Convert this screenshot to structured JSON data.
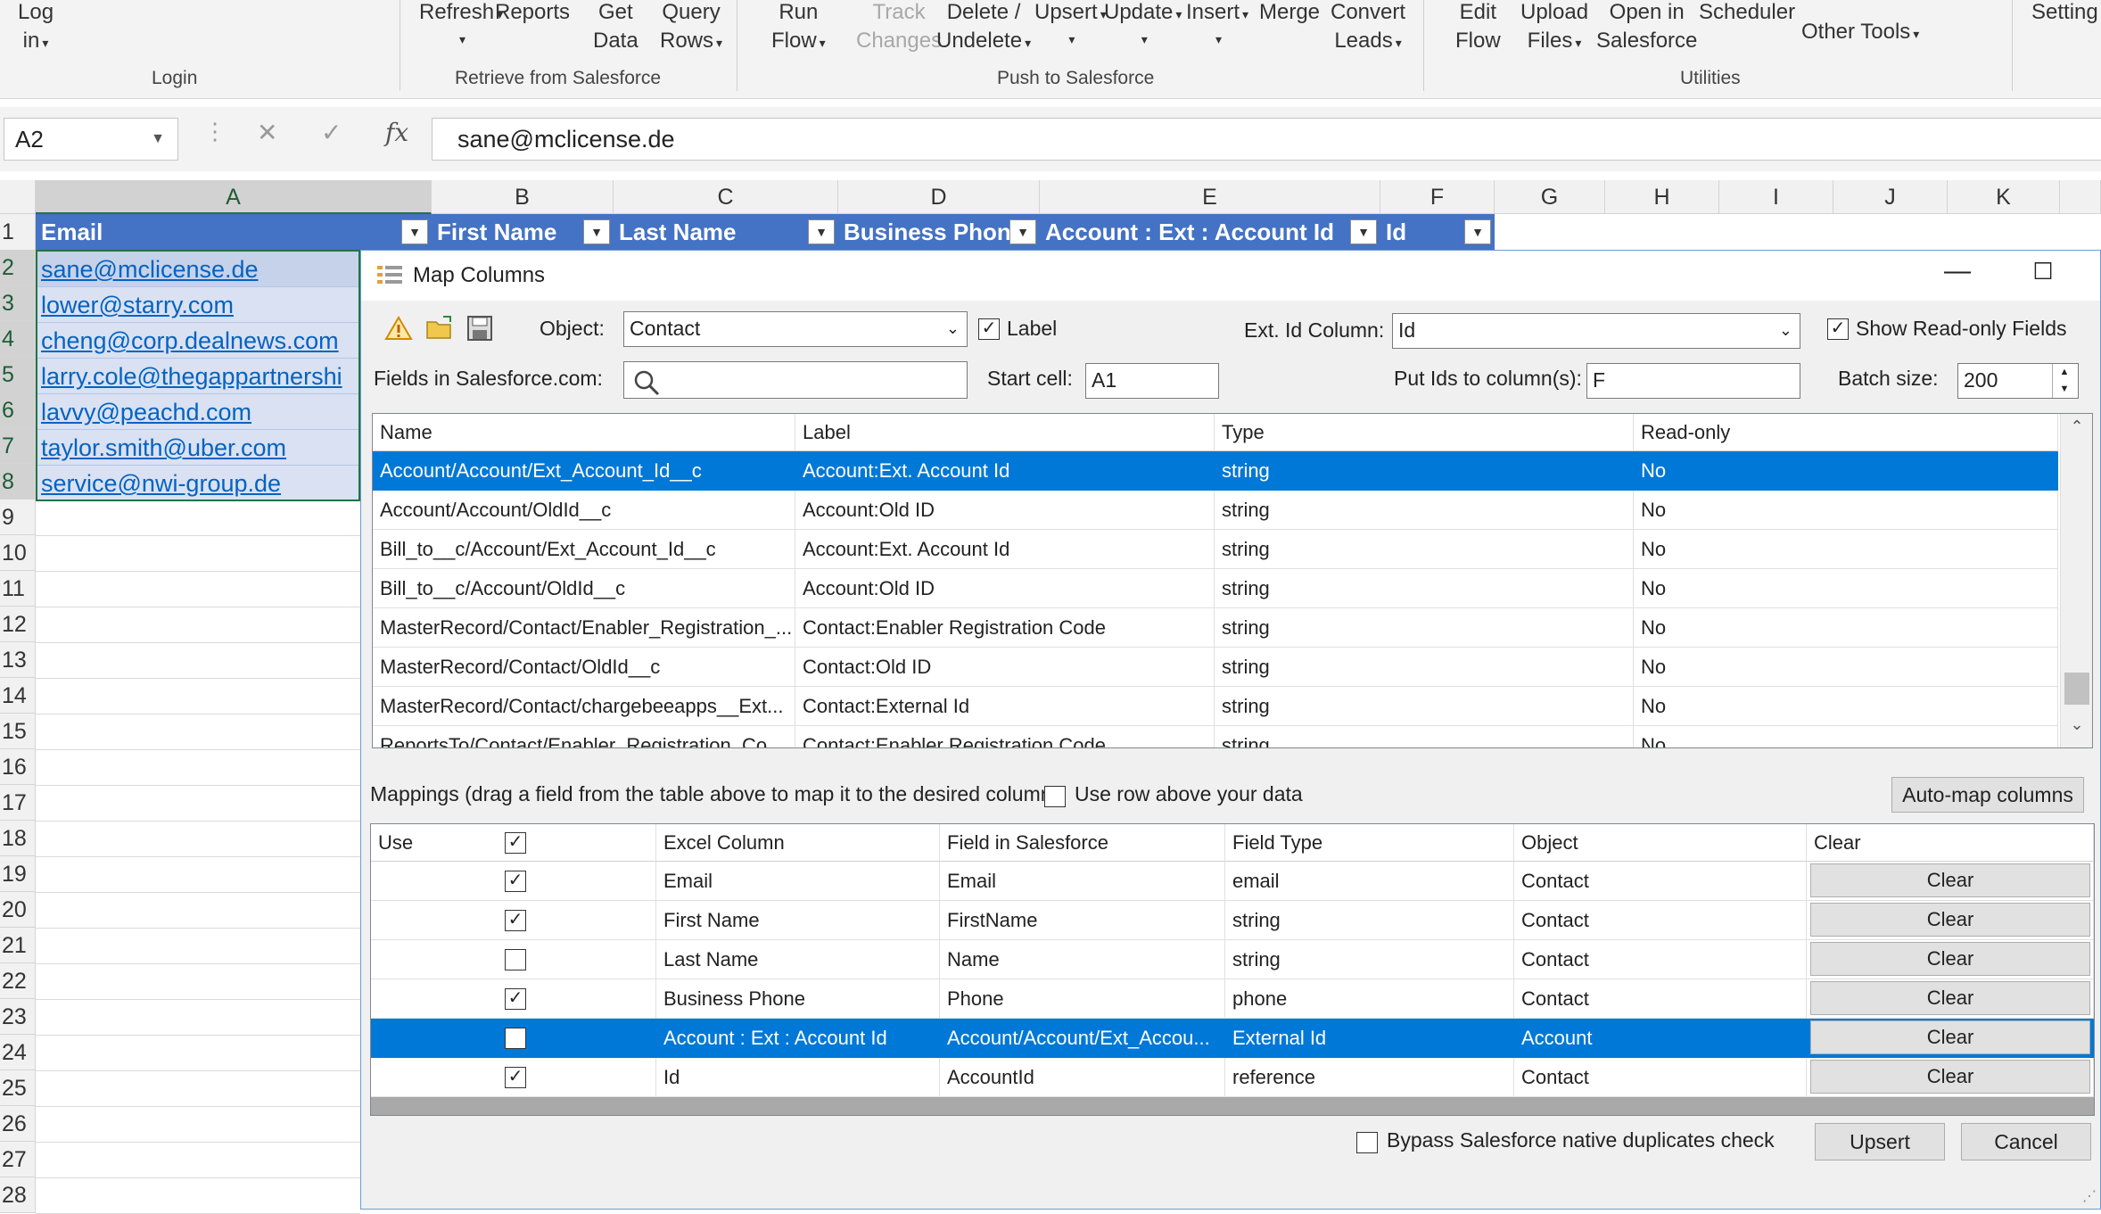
{
  "ribbon": {
    "buttons": [
      {
        "label": "Log\nin",
        "dropdown": true
      },
      {
        "label": "Refresh",
        "dropdown": true
      },
      {
        "label": "Reports",
        "dropdown": false
      },
      {
        "label": "Get\nData",
        "dropdown": false
      },
      {
        "label": "Query\nRows",
        "dropdown": true
      },
      {
        "label": "Run\nFlow",
        "dropdown": true
      },
      {
        "label": "Track\nChanges",
        "dropdown": false,
        "disabled": true
      },
      {
        "label": "Delete /\nUndelete",
        "dropdown": true
      },
      {
        "label": "Upsert",
        "dropdown": true
      },
      {
        "label": "Update",
        "dropdown": true
      },
      {
        "label": "Insert",
        "dropdown": true
      },
      {
        "label": "Merge",
        "dropdown": false
      },
      {
        "label": "Convert\nLeads",
        "dropdown": true
      },
      {
        "label": "Edit\nFlow",
        "dropdown": false
      },
      {
        "label": "Upload\nFiles",
        "dropdown": true
      },
      {
        "label": "Open in\nSalesforce",
        "dropdown": false
      },
      {
        "label": "Scheduler",
        "dropdown": false
      },
      {
        "label": "Other Tools",
        "dropdown": true
      },
      {
        "label": "Setting",
        "dropdown": false
      }
    ],
    "groups": [
      "Login",
      "Retrieve from Salesforce",
      "Push to Salesforce",
      "Utilities"
    ]
  },
  "formula_bar": {
    "name_box": "A2",
    "cancel": "✕",
    "enter": "✓",
    "fx": "fx",
    "value": "sane@mclicense.de"
  },
  "sheet": {
    "columns": [
      "A",
      "B",
      "C",
      "D",
      "E",
      "F",
      "G",
      "H",
      "I",
      "J",
      "K"
    ],
    "rows": [
      "1",
      "2",
      "3",
      "4",
      "5",
      "6",
      "7",
      "8",
      "9",
      "10",
      "11",
      "12",
      "13",
      "14",
      "15",
      "16",
      "17",
      "18",
      "19",
      "20",
      "21",
      "22",
      "23",
      "24",
      "25",
      "26",
      "27",
      "28"
    ],
    "headers": [
      "Email",
      "First Name",
      "Last Name",
      "Business Phone",
      "Account : Ext : Account Id",
      "Id"
    ],
    "emails": [
      "sane@mclicense.de",
      "lower@starry.com",
      "cheng@corp.dealnews.com",
      "larry.cole@thegappartnershi",
      "lavvy@peachd.com",
      "taylor.smith@uber.com",
      "service@nwi-group.de"
    ]
  },
  "dialog": {
    "title": "Map Columns",
    "object_label": "Object:",
    "object_value": "Contact",
    "label_checkbox": "Label",
    "ext_id_label": "Ext. Id Column:",
    "ext_id_value": "Id",
    "show_readonly": "Show Read-only Fields",
    "fields_label": "Fields in Salesforce.com:",
    "search_value": "",
    "start_cell_label": "Start cell:",
    "start_cell_value": "A1",
    "put_ids_label": "Put Ids to column(s):",
    "put_ids_value": "F",
    "batch_label": "Batch size:",
    "batch_value": "200",
    "fields_table": {
      "headers": [
        "Name",
        "Label",
        "Type",
        "Read-only"
      ],
      "rows": [
        [
          "Account/Account/Ext_Account_Id__c",
          "Account:Ext. Account Id",
          "string",
          "No"
        ],
        [
          "Account/Account/OldId__c",
          "Account:Old ID",
          "string",
          "No"
        ],
        [
          "Bill_to__c/Account/Ext_Account_Id__c",
          "Account:Ext. Account Id",
          "string",
          "No"
        ],
        [
          "Bill_to__c/Account/OldId__c",
          "Account:Old ID",
          "string",
          "No"
        ],
        [
          "MasterRecord/Contact/Enabler_Registration_...",
          "Contact:Enabler Registration Code",
          "string",
          "No"
        ],
        [
          "MasterRecord/Contact/OldId__c",
          "Contact:Old ID",
          "string",
          "No"
        ],
        [
          "MasterRecord/Contact/chargebeeapps__Ext...",
          "Contact:External Id",
          "string",
          "No"
        ],
        [
          "ReportsTo/Contact/Enabler_Registration_Co...",
          "Contact:Enabler Registration Code",
          "string",
          "No"
        ]
      ]
    },
    "mappings_label": "Mappings (drag a field from the table above to map it to the desired column):",
    "use_row_above": "Use row above your data",
    "automap_button": "Auto-map columns",
    "mappings_table": {
      "headers": [
        "Use",
        "Excel Column",
        "Field in Salesforce",
        "Field Type",
        "Object",
        "Clear"
      ],
      "rows": [
        {
          "use": true,
          "excel": "Email",
          "field": "Email",
          "type": "email",
          "object": "Contact",
          "clear": "Clear"
        },
        {
          "use": true,
          "excel": "First Name",
          "field": "FirstName",
          "type": "string",
          "object": "Contact",
          "clear": "Clear"
        },
        {
          "use": false,
          "excel": "Last Name",
          "field": "Name",
          "type": "string",
          "object": "Contact",
          "clear": "Clear"
        },
        {
          "use": true,
          "excel": "Business Phone",
          "field": "Phone",
          "type": "phone",
          "object": "Contact",
          "clear": "Clear"
        },
        {
          "use": true,
          "excel": "Account : Ext :  Account Id",
          "field": "Account/Account/Ext_Accou...",
          "type": "External Id",
          "object": "Account",
          "clear": "Clear"
        },
        {
          "use": true,
          "excel": "Id",
          "field": "AccountId",
          "type": "reference",
          "object": "Contact",
          "clear": "Clear"
        }
      ]
    },
    "bypass_label": "Bypass Salesforce native duplicates check",
    "upsert_button": "Upsert",
    "cancel_button": "Cancel"
  }
}
